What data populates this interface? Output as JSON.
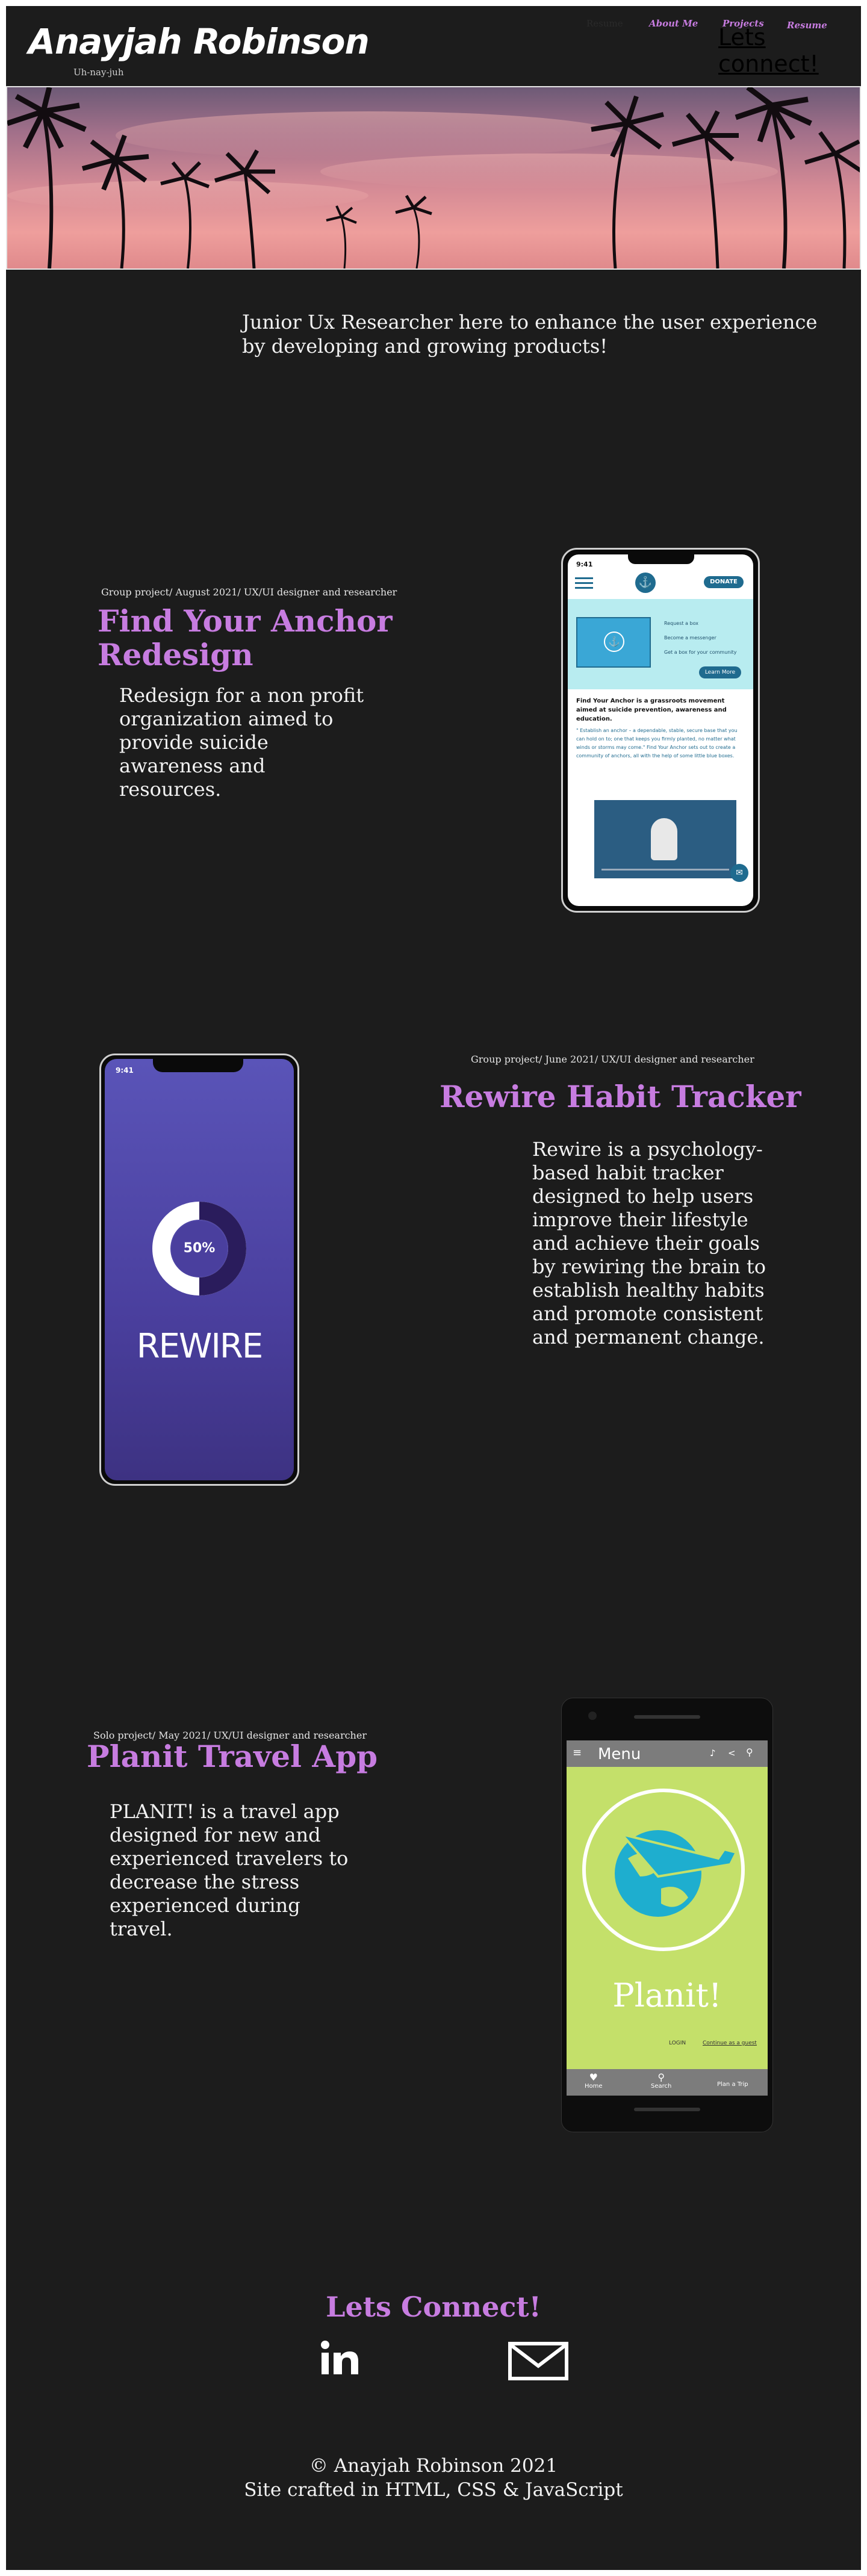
{
  "header": {
    "brand": "Anayjah Robinson",
    "pronunciation": "Uh-nay-juh",
    "nav": [
      {
        "label": "Resume"
      },
      {
        "label": "About Me"
      },
      {
        "label": "Projects"
      },
      {
        "label": "Resume"
      }
    ],
    "cta": "Lets connect!"
  },
  "hero": {
    "image": "sunset-palm-trees-banner"
  },
  "intro": {
    "tagline": "Junior Ux Researcher here to enhance the user experience by developing and growing products!"
  },
  "projects": [
    {
      "meta": "Group project/ August 2021/ UX/UI designer and researcher",
      "title": "Find Your Anchor Redesign",
      "description": "Redesign for a non profit organization aimed to provide suicide awareness and resources.",
      "mockup": {
        "time": "9:41",
        "donate": "DONATE",
        "menu_items": [
          "Request a box",
          "Become a messenger",
          "Get a box for your community"
        ],
        "learn_more": "Learn More",
        "heading": "Find Your Anchor is a grassroots movement aimed at suicide prevention, awareness and education.",
        "body": "\" Establish an anchor – a dependable, stable, secure base that you can hold on to; one that keeps you firmly planted, no matter what winds or storms may come.\" Find Your Anchor sets out to create a community of anchors, all with the help of some little blue boxes."
      }
    },
    {
      "meta": "Group project/ June 2021/ UX/UI designer and researcher",
      "title": "Rewire Habit Tracker",
      "description": "Rewire is a psychology-based habit tracker designed to help users improve their lifestyle and achieve their goals by rewiring the brain to establish healthy habits and promote consistent and permanent change.",
      "mockup": {
        "time": "9:41",
        "progress_label": "50%",
        "progress": 0.5,
        "app_name": "REWIRE"
      }
    },
    {
      "meta": "Solo project/ May 2021/ UX/UI designer and researcher",
      "title": "Planit Travel App",
      "description": "PLANIT! is a travel app designed for new and experienced travelers to decrease the stress experienced during travel.",
      "mockup": {
        "menu": "Menu",
        "app_name": "Planit!",
        "login": "LOGIN",
        "guest": "Continue as a guest",
        "tabs": [
          "Home",
          "Search",
          "Plan a Trip"
        ]
      }
    }
  ],
  "connect": {
    "title": "Lets Connect!",
    "links": [
      {
        "icon": "linkedin-icon"
      },
      {
        "icon": "email-icon"
      }
    ]
  },
  "footer": {
    "copyright": "© Anayjah Robinson 2021",
    "crafted": "Site crafted in HTML, CSS & JavaScript"
  },
  "colors": {
    "accent": "#c77ce0",
    "background": "#1c1c1c",
    "text": "#f2f2f2"
  }
}
